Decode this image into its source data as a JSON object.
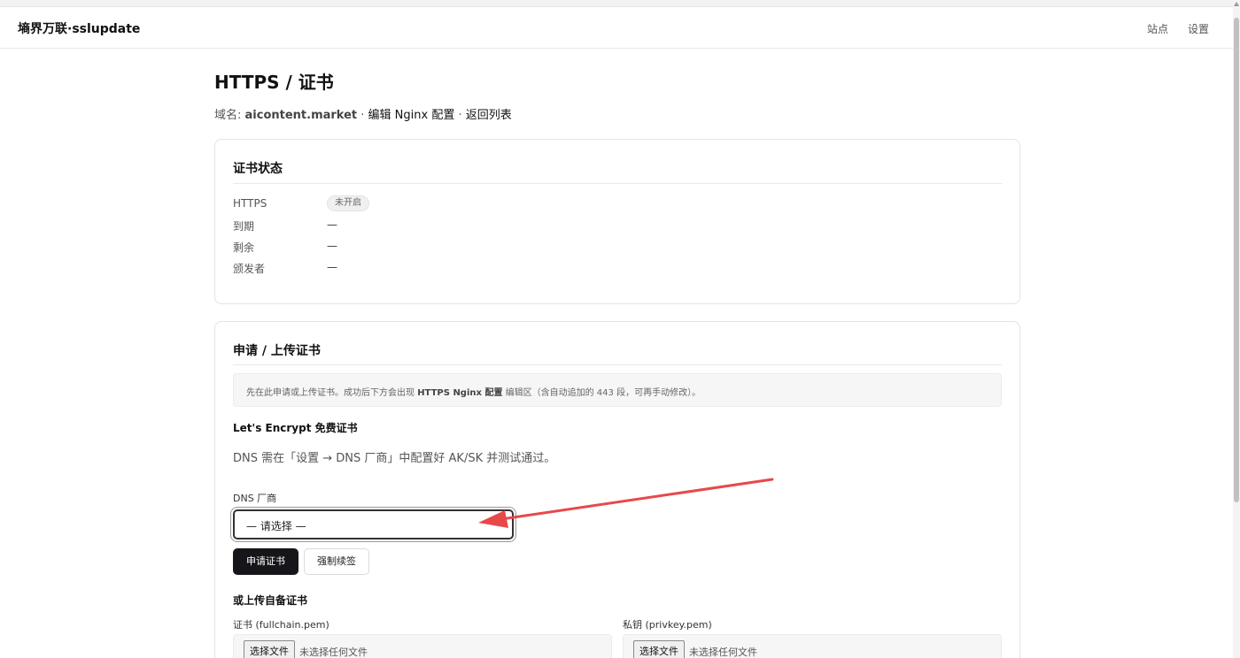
{
  "navbar": {
    "brand": "墒界万联·sslupdate",
    "links": {
      "sites": "站点",
      "settings": "设置"
    }
  },
  "page": {
    "title": "HTTPS / 证书",
    "breadcrumb": {
      "domain_prefix": "域名: ",
      "domain": "aicontent.market",
      "sep1": " · ",
      "edit_nginx": "编辑 Nginx 配置",
      "sep2": " · ",
      "back_to_list": "返回列表"
    }
  },
  "cert_status": {
    "title": "证书状态",
    "https_label": "HTTPS",
    "https_badge": "未开启",
    "expiry_label": "到期",
    "expiry_value": "—",
    "remaining_label": "剩余",
    "remaining_value": "—",
    "issuer_label": "颁发者",
    "issuer_value": "—"
  },
  "apply": {
    "title": "申请 / 上传证书",
    "notice_pre": "先在此申请或上传证书。成功后下方会出现 ",
    "notice_bold": "HTTPS Nginx 配置",
    "notice_post": " 编辑区（含自动追加的 443 段，可再手动修改）。",
    "le_title": "Let's Encrypt 免费证书",
    "dns_hint": "DNS 需在「设置 → DNS 厂商」中配置好 AK/SK 并测试通过。",
    "dns_label": "DNS 厂商",
    "dns_select_value": "— 请选择 —",
    "apply_button": "申请证书",
    "force_renew_button": "强制续签",
    "upload_title": "或上传自备证书",
    "cert_label": "证书 (fullchain.pem)",
    "key_label": "私钥 (privkey.pem)",
    "choose_file_button": "选择文件",
    "no_file_text": "未选择任何文件"
  },
  "colors": {
    "primary_button": "#16161a",
    "annotation_arrow": "#e8484a"
  }
}
